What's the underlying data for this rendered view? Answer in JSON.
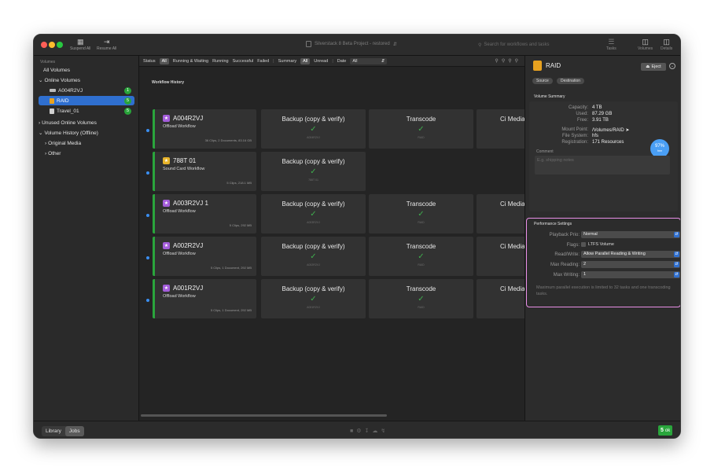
{
  "window": {
    "title": "Silverstack 8 Beta Project - restored",
    "search_placeholder": "Search for workflows and tasks"
  },
  "toolbar": {
    "suspend_label": "Suspend All",
    "resume_label": "Resume All",
    "tasks_label": "Tasks",
    "volumes_label": "Volumes",
    "details_label": "Details"
  },
  "sidebar": {
    "header": "Volumes",
    "all_volumes": "All Volumes",
    "online_volumes": "Online Volumes",
    "online_items": [
      {
        "label": "A004R2VJ",
        "badge": "1"
      },
      {
        "label": "RAID",
        "badge": "5"
      },
      {
        "label": "Travel_01",
        "badge": "5"
      }
    ],
    "unused_online": "Unused Online Volumes",
    "history_offline": "Volume History (Offline)",
    "original_media": "Original Media",
    "other": "Other"
  },
  "filter": {
    "status_label": "Status",
    "all_label": "All",
    "running_waiting": "Running & Waiting",
    "running": "Running",
    "successful": "Successful",
    "failed": "Failed",
    "summary_label": "Summary",
    "summary_all": "All",
    "unread": "Unread",
    "date_label": "Date",
    "date_value": "All"
  },
  "workflow": {
    "header": "Workflow History",
    "jobs": [
      {
        "name": "A004R2VJ",
        "type": "Offload Workflow",
        "meta": "36 Clips, 2 Documents, 83.16 GB",
        "tasks": [
          {
            "title": "Backup (copy & verify)",
            "sub": "A004R2VJ"
          },
          {
            "title": "Transcode",
            "sub": "RAID"
          },
          {
            "title": "Ci Media C"
          }
        ]
      },
      {
        "name": "788T 01",
        "type": "Sound Card Workflow",
        "meta": "5 Clips, 218.1 MB",
        "tasks": [
          {
            "title": "Backup (copy & verify)",
            "sub": "788T 01"
          }
        ]
      },
      {
        "name": "A003R2VJ 1",
        "type": "Offload Workflow",
        "meta": "5 Clips, 292 MB",
        "tasks": [
          {
            "title": "Backup (copy & verify)",
            "sub": "A003R2VJ"
          },
          {
            "title": "Transcode",
            "sub": "RAID"
          },
          {
            "title": "Ci Media C"
          }
        ]
      },
      {
        "name": "A002R2VJ",
        "type": "Offload Workflow",
        "meta": "5 Clips, 1 Document, 292 MB",
        "tasks": [
          {
            "title": "Backup (copy & verify)",
            "sub": "A002R2VJ"
          },
          {
            "title": "Transcode",
            "sub": "RAID"
          },
          {
            "title": "Ci Media C"
          }
        ]
      },
      {
        "name": "A001R2VJ",
        "type": "Offload Workflow",
        "meta": "5 Clips, 1 Document, 292 MB",
        "tasks": [
          {
            "title": "Backup (copy & verify)",
            "sub": "A001R2VJ"
          },
          {
            "title": "Transcode",
            "sub": "RAID"
          },
          {
            "title": "Ci Media C"
          }
        ]
      }
    ]
  },
  "details": {
    "volume_name": "RAID",
    "eject_label": "Eject",
    "source_tab": "Source",
    "destination_tab": "Destination",
    "summary_header": "Volume Summary",
    "capacity_label": "Capacity:",
    "capacity": "4 TB",
    "used_label": "Used:",
    "used": "87.29 GB",
    "free_label": "Free:",
    "free": "3.91 TB",
    "mount_label": "Mount Point:",
    "mount": "/Volumes/RAID",
    "fs_label": "File System:",
    "fs": "hfs",
    "reg_label": "Registration:",
    "reg": "171 Resources",
    "free_pct": "97%",
    "free_word": "free",
    "comment_label": "Comment",
    "comment_placeholder": "E.g. shipping notes",
    "perf_header": "Performance Settings",
    "playback_label": "Playback Prio:",
    "playback": "Normal",
    "flags_label": "Flags:",
    "flags": "LTFS Volume",
    "rw_label": "Read/Write:",
    "rw": "Allow Parallel Reading & Writing",
    "max_read_label": "Max Reading:",
    "max_read": "2",
    "max_write_label": "Max Writing:",
    "max_write": "1",
    "perf_note": "Maximum parallel execution is limited to 32 tasks and one transcoding tasks."
  },
  "bottom": {
    "library_tab": "Library",
    "jobs_tab": "Jobs",
    "ok_count": "5",
    "ok_label": "ok"
  },
  "colors": {
    "accent": "#2f6fcf",
    "success": "#2aa53c",
    "highlight": "#e98fe7"
  }
}
